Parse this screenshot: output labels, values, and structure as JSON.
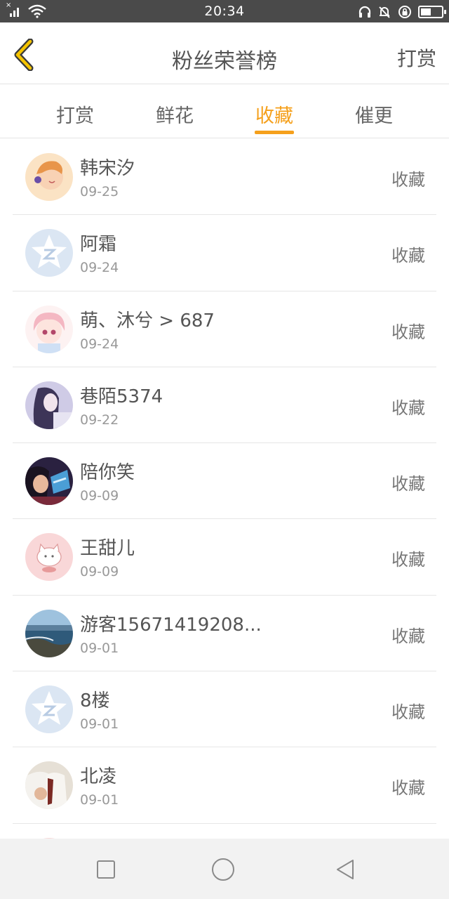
{
  "status_bar": {
    "time": "20:34"
  },
  "header": {
    "title": "粉丝荣誉榜",
    "action": "打赏"
  },
  "tabs": [
    {
      "label": "打赏",
      "active": false
    },
    {
      "label": "鲜花",
      "active": false
    },
    {
      "label": "收藏",
      "active": true
    },
    {
      "label": "催更",
      "active": false
    }
  ],
  "accent_color": "#f5a01c",
  "fans": [
    {
      "name": "韩宋汐",
      "date": "09-25",
      "action": "收藏",
      "avatar": "illustrated-girl-avatar"
    },
    {
      "name": "阿霜",
      "date": "09-24",
      "action": "收藏",
      "avatar": "default-star-avatar"
    },
    {
      "name": "萌、沐兮 > 687",
      "date": "09-24",
      "action": "收藏",
      "avatar": "anime-girl-avatar"
    },
    {
      "name": "巷陌5374",
      "date": "09-22",
      "action": "收藏",
      "avatar": "girl-photo-avatar"
    },
    {
      "name": "陪你笑",
      "date": "09-09",
      "action": "收藏",
      "avatar": "selfie-photo-avatar"
    },
    {
      "name": "王甜儿",
      "date": "09-09",
      "action": "收藏",
      "avatar": "cartoon-cat-avatar"
    },
    {
      "name": "游客15671419208...",
      "date": "09-01",
      "action": "收藏",
      "avatar": "sea-photo-avatar"
    },
    {
      "name": "8楼",
      "date": "09-01",
      "action": "收藏",
      "avatar": "default-star-avatar"
    },
    {
      "name": "北凌",
      "date": "09-01",
      "action": "收藏",
      "avatar": "uniform-photo-avatar"
    }
  ]
}
